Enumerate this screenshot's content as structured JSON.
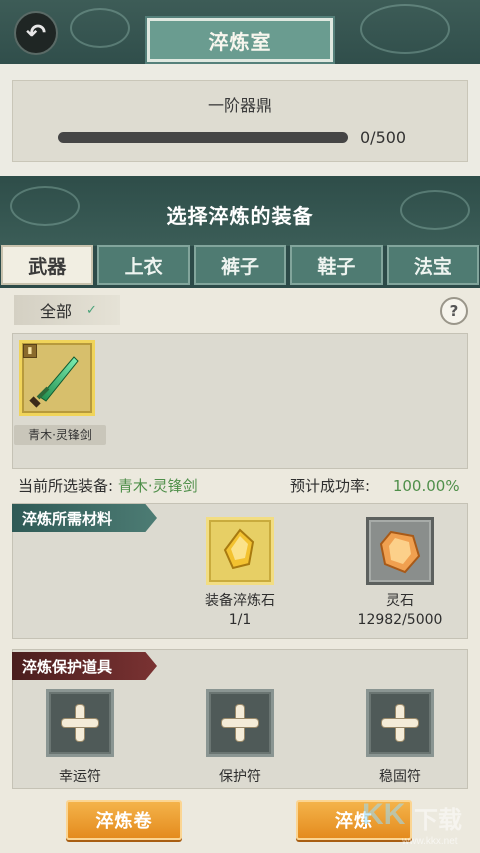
{
  "header": {
    "title": "淬炼室",
    "back_icon": "back-arrow-icon"
  },
  "cauldron": {
    "name": "一阶器鼎",
    "progress_current": 0,
    "progress_max": 500,
    "progress_text": "0/500"
  },
  "section_title": "选择淬炼的装备",
  "tabs": [
    {
      "label": "武器",
      "active": true
    },
    {
      "label": "上衣",
      "active": false
    },
    {
      "label": "裤子",
      "active": false
    },
    {
      "label": "鞋子",
      "active": false
    },
    {
      "label": "法宝",
      "active": false
    }
  ],
  "filter": {
    "label": "全部",
    "chevron_icon": "chevron-down-icon"
  },
  "help_label": "?",
  "equipment": [
    {
      "name": "青木·灵锋剑",
      "icon": "jade-sword-icon",
      "selected": true
    }
  ],
  "selection": {
    "current_label": "当前所选装备:",
    "current_value": "青木·灵锋剑",
    "rate_label": "预计成功率:",
    "rate_value": "100.00%"
  },
  "materials": {
    "title": "淬炼所需材料",
    "items": [
      {
        "name": "装备淬炼石",
        "count": "1/1",
        "icon": "refining-stone-icon"
      },
      {
        "name": "灵石",
        "count": "12982/5000",
        "icon": "spirit-stone-icon"
      }
    ]
  },
  "protection": {
    "title": "淬炼保护道具",
    "items": [
      {
        "name": "幸运符",
        "icon": "plus-icon"
      },
      {
        "name": "保护符",
        "icon": "plus-icon"
      },
      {
        "name": "稳固符",
        "icon": "plus-icon"
      }
    ]
  },
  "buttons": {
    "scroll_label": "淬炼卷",
    "refine_label": "淬炼"
  },
  "watermark": {
    "logo": "KK",
    "text": "下载",
    "url": "www.kkx.net"
  },
  "colors": {
    "accent_teal": "#4f7b72",
    "button_orange": "#e48b1e",
    "success_green": "#4f8f4a",
    "gold_slot": "#e7cf65"
  }
}
